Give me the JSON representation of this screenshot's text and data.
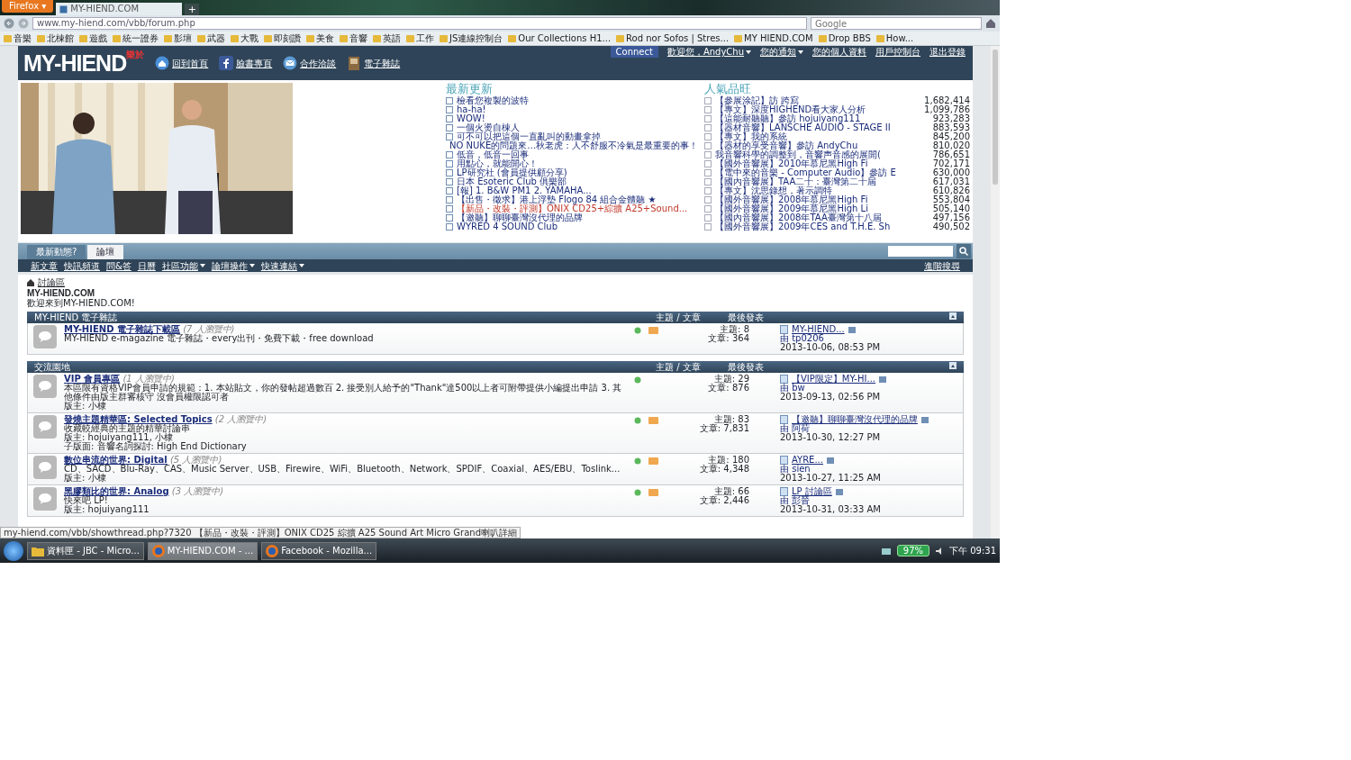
{
  "browser": {
    "menu_button": "Firefox ▾",
    "tabs": [
      {
        "title": "MY-HIEND.COM",
        "selected": true
      }
    ],
    "new_tab": "+",
    "address": "www.my-hiend.com/vbb/forum.php",
    "search_placeholder": "Google",
    "bookmarks": [
      "音樂",
      "北棟館",
      "遊戲",
      "統一證券",
      "影壇",
      "武器",
      "大戰",
      "即刻讚",
      "美食",
      "音響",
      "英語",
      "工作",
      "JS連線控制台",
      "Our Collections H1...",
      "Rod nor Sofos | Stres...",
      "MY HIEND.COM",
      "Drop BBS",
      "How..."
    ]
  },
  "site": {
    "logo": "MY-HIEND",
    "logo_badge": "樂於",
    "connect": "Connect",
    "nav_links": [
      {
        "label": "回到首頁",
        "kind": "home"
      },
      {
        "label": "臉書專頁",
        "kind": "facebook"
      },
      {
        "label": "合作洽談",
        "kind": "mail"
      },
      {
        "label": "電子雜誌",
        "kind": "magazine"
      }
    ],
    "user_links": [
      {
        "label": "歡迎您，AndyChu",
        "dropdown": true
      },
      {
        "label": "您的通知",
        "dropdown": true
      },
      {
        "label": "您的個人資料",
        "dropdown": false
      },
      {
        "label": "用戶控制台",
        "dropdown": false
      },
      {
        "label": "退出登錄",
        "dropdown": false
      }
    ]
  },
  "latest": {
    "title": "最新更新",
    "items": [
      {
        "text": "檢看您複製的波特",
        "highlight": false
      },
      {
        "text": "ha-ha!",
        "highlight": false
      },
      {
        "text": "WOW!",
        "highlight": false
      },
      {
        "text": "一個火燙自棟人",
        "highlight": false
      },
      {
        "text": "可不可以把這個一直亂叫的動畫拿掉",
        "highlight": false
      },
      {
        "text": "NO NUKE的問題來…秋老虎：人不舒服不冷氣是最重要的事！",
        "highlight": false
      },
      {
        "text": "低音，低音一回事",
        "highlight": false
      },
      {
        "text": "用點心，就能開心！",
        "highlight": false
      },
      {
        "text": "LP研究社 (會員提供顧分享)",
        "highlight": false
      },
      {
        "text": "日本 Esoteric Club 俱樂部",
        "highlight": false
      },
      {
        "text": "[報] 1. B&W PM1 2. YAMAHA...",
        "highlight": false
      },
      {
        "text": "【出售・徵求】港上浮墊 Flogo 84 組合金體聽 ★",
        "highlight": false
      },
      {
        "text": "【新品・改裝・評測】ONIX CD25+綜擴 A25+Sound...",
        "highlight": true
      },
      {
        "text": "【邀聽】聊聊臺灣沒代理的品牌",
        "highlight": false
      },
      {
        "text": "WYRED 4 SOUND Club",
        "highlight": false
      }
    ]
  },
  "popular": {
    "title": "人氣品旺",
    "items": [
      {
        "text": "【參展涂記】訪 跨寫",
        "count": "1,682,414"
      },
      {
        "text": "【專文】深度HIGHEND看大家人分析",
        "count": "1,099,786"
      },
      {
        "text": "【這能耐聽聽】參訪 hojuiyang111",
        "count": "923,283"
      },
      {
        "text": "【器材音響】LANSCHE AUDIO - STAGE II",
        "count": "883,593"
      },
      {
        "text": "【專文】我的系統",
        "count": "845,200"
      },
      {
        "text": "【器材的享受音響】參訪 AndyChu",
        "count": "810,020"
      },
      {
        "text": "我音響科學的調整到，音響声音感的展開(",
        "count": "786,651"
      },
      {
        "text": "【國外音響展】2010年慕尼黑High Fi",
        "count": "702,171"
      },
      {
        "text": "【電中來的音樂 - Computer Audio】參訪 E",
        "count": "630,000"
      },
      {
        "text": "【國內音響展】TAA二十：臺灣第二十屆",
        "count": "617,031"
      },
      {
        "text": "【專文】沈思錄想，著示調特",
        "count": "610,826"
      },
      {
        "text": "【國外音響展】2008年慕尼黑High Fi",
        "count": "553,804"
      },
      {
        "text": "【國外音響展】2009年慕尼黑High Li",
        "count": "505,140"
      },
      {
        "text": "【國內音響展】2008年TAA臺灣第十八屆",
        "count": "497,156"
      },
      {
        "text": "【國外音響展】2009年CES and T.H.E. Sh",
        "count": "490,502"
      }
    ]
  },
  "main_tabs": [
    {
      "label": "最新動態?",
      "selected": false
    },
    {
      "label": "論壇",
      "selected": true
    }
  ],
  "sub_nav": [
    {
      "label": "新文章",
      "dropdown": false
    },
    {
      "label": "快訊頻道",
      "dropdown": false
    },
    {
      "label": "問&答",
      "dropdown": false
    },
    {
      "label": "日曆",
      "dropdown": false
    },
    {
      "label": "社區功能",
      "dropdown": true
    },
    {
      "label": "論壇操作",
      "dropdown": true
    },
    {
      "label": "快速連結",
      "dropdown": true
    }
  ],
  "advanced_search": "進階搜尋",
  "breadcrumb": "討論區",
  "forum_title": "MY-HIEND.COM",
  "forum_welcome": "歡迎來到MY-HIEND.COM!",
  "categories": [
    {
      "title": "MY-HIEND 電子雜誌",
      "col_stats": "主題 / 文章",
      "col_last": "最後發表",
      "forums": [
        {
          "title": "MY-HIEND 電子雜誌下載區",
          "viewers": "(7 人瀏覽中)",
          "description": "MY-HIEND e-magazine 電子雜誌・every出刊・免費下載・free download",
          "rss": true,
          "topics": "主題: 8",
          "posts": "文章: 364",
          "last_title": "MY-HIEND...",
          "last_by": "由 tp0206",
          "last_time": "2013-10-06, 08:53 PM"
        }
      ]
    },
    {
      "title": "交流園地",
      "col_stats": "主題 / 文章",
      "col_last": "最後發表",
      "forums": [
        {
          "title": "VIP 會員專區",
          "viewers": "(1 人瀏覽中)",
          "description": "本區限有資格VIP會員申請的規範：1. 本站貼文，你的發帖超過數百 2. 接受別人給予的\"Thank\"達500以上者可附帶提供小編提出申請 3. 其他條件由版主群審核守 沒會員權限認可者",
          "moderators": "版主: 小棣",
          "rss": false,
          "topics": "主題: 29",
          "posts": "文章: 876",
          "last_title": "【VIP限定】MY-HI...",
          "last_by": "由 bw",
          "last_time": "2013-09-13, 02:56 PM"
        },
        {
          "title": "發燒主題精華區: Selected Topics",
          "viewers": "(2 人瀏覽中)",
          "description": "收藏較經典的主題的精華討論串",
          "moderators": "版主: hojuiyang111, 小棣",
          "subforums": "子版面: 音響名詞探討: High End Dictionary",
          "rss": true,
          "topics": "主題: 83",
          "posts": "文章: 7,831",
          "last_title": "【邀聽】聊聊臺灣沒代理的品牌",
          "last_by": "由 阿荷",
          "last_time": "2013-10-30, 12:27 PM"
        },
        {
          "title": "數位串流的世界: Digital",
          "viewers": "(5 人瀏覽中)",
          "description": "CD、SACD、Blu-Ray、CAS、Music Server、USB、Firewire、WiFi、Bluetooth、Network、SPDIF、Coaxial、AES/EBU、Toslink...",
          "moderators": "版主: 小棣",
          "rss": true,
          "topics": "主題: 180",
          "posts": "文章: 4,348",
          "last_title": "AYRE...",
          "last_by": "由 sien",
          "last_time": "2013-10-27, 11:25 AM"
        },
        {
          "title": "黑膠類比的世界: Analog",
          "viewers": "(3 人瀏覽中)",
          "description": "快來吧 LP!",
          "moderators": "版主: hojuiyang111",
          "rss": true,
          "topics": "主題: 66",
          "posts": "文章: 2,446",
          "last_title": "LP 討論區",
          "last_by": "由 彭晉",
          "last_time": "2013-10-31, 03:33 AM"
        }
      ]
    }
  ],
  "status_url": "my-hiend.com/vbb/showthread.php?7320 【新品・改裝・評測】ONIX CD25 綜擴 A25 Sound Art Micro Grand喇叭詳細",
  "taskbar": {
    "buttons": [
      {
        "label": "資料匣 - JBC - Micro...",
        "selected": false,
        "kind": "folder"
      },
      {
        "label": "MY-HIEND.COM - ...",
        "selected": true,
        "kind": "browser"
      },
      {
        "label": "Facebook - Mozilla...",
        "selected": false,
        "kind": "browser"
      }
    ],
    "battery": "97%",
    "clock": "下午 09:31"
  }
}
